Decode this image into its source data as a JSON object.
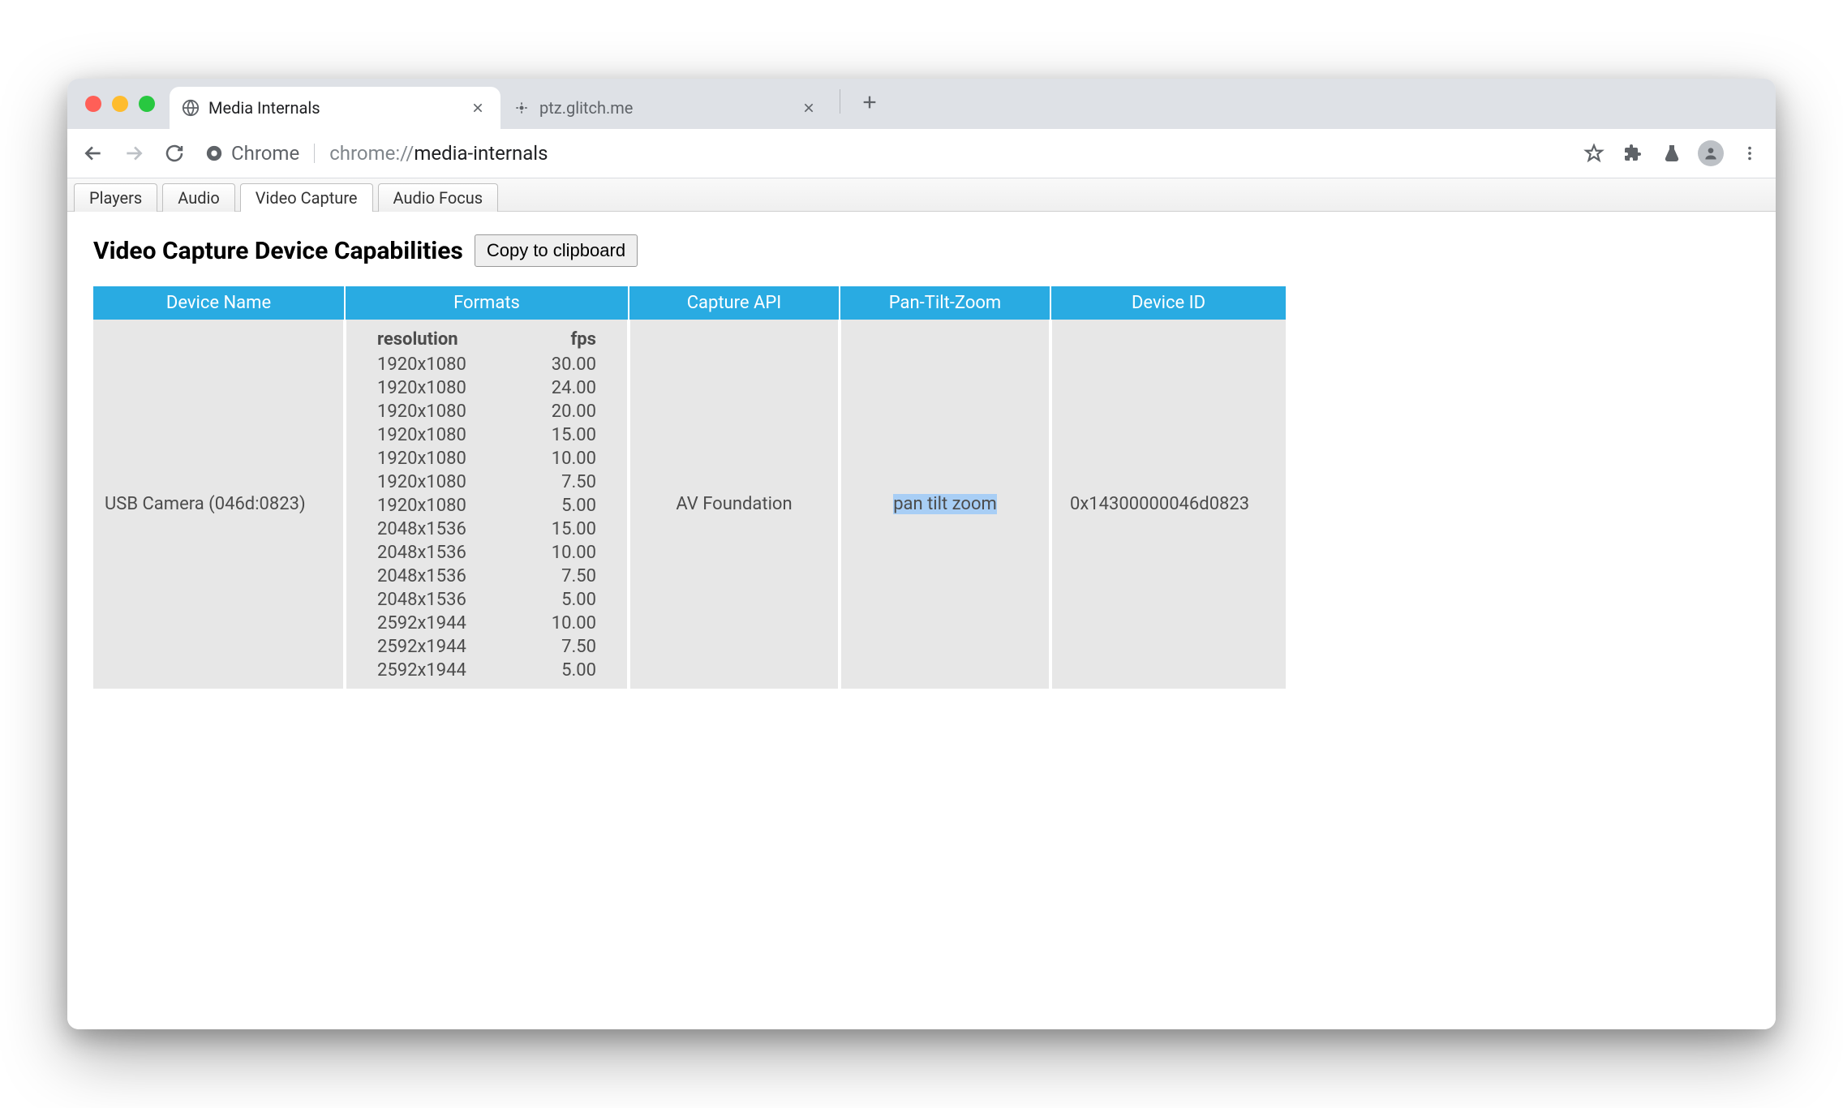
{
  "browser": {
    "tabs": [
      {
        "title": "Media Internals",
        "active": true
      },
      {
        "title": "ptz.glitch.me",
        "active": false
      }
    ]
  },
  "omnibox": {
    "chip_label": "Chrome",
    "url_scheme": "chrome://",
    "url_path": "media-internals"
  },
  "page_tabs": [
    {
      "label": "Players",
      "selected": false
    },
    {
      "label": "Audio",
      "selected": false
    },
    {
      "label": "Video Capture",
      "selected": true
    },
    {
      "label": "Audio Focus",
      "selected": false
    }
  ],
  "page": {
    "title": "Video Capture Device Capabilities",
    "copy_button_label": "Copy to clipboard"
  },
  "table": {
    "headers": [
      "Device Name",
      "Formats",
      "Capture API",
      "Pan-Tilt-Zoom",
      "Device ID"
    ],
    "formats_header": {
      "resolution": "resolution",
      "fps": "fps"
    },
    "row": {
      "device_name": "USB Camera (046d:0823)",
      "capture_api": "AV Foundation",
      "ptz": "pan tilt zoom",
      "device_id": "0x14300000046d0823",
      "formats": [
        {
          "resolution": "1920x1080",
          "fps": "30.00"
        },
        {
          "resolution": "1920x1080",
          "fps": "24.00"
        },
        {
          "resolution": "1920x1080",
          "fps": "20.00"
        },
        {
          "resolution": "1920x1080",
          "fps": "15.00"
        },
        {
          "resolution": "1920x1080",
          "fps": "10.00"
        },
        {
          "resolution": "1920x1080",
          "fps": "7.50"
        },
        {
          "resolution": "1920x1080",
          "fps": "5.00"
        },
        {
          "resolution": "2048x1536",
          "fps": "15.00"
        },
        {
          "resolution": "2048x1536",
          "fps": "10.00"
        },
        {
          "resolution": "2048x1536",
          "fps": "7.50"
        },
        {
          "resolution": "2048x1536",
          "fps": "5.00"
        },
        {
          "resolution": "2592x1944",
          "fps": "10.00"
        },
        {
          "resolution": "2592x1944",
          "fps": "7.50"
        },
        {
          "resolution": "2592x1944",
          "fps": "5.00"
        }
      ]
    }
  }
}
